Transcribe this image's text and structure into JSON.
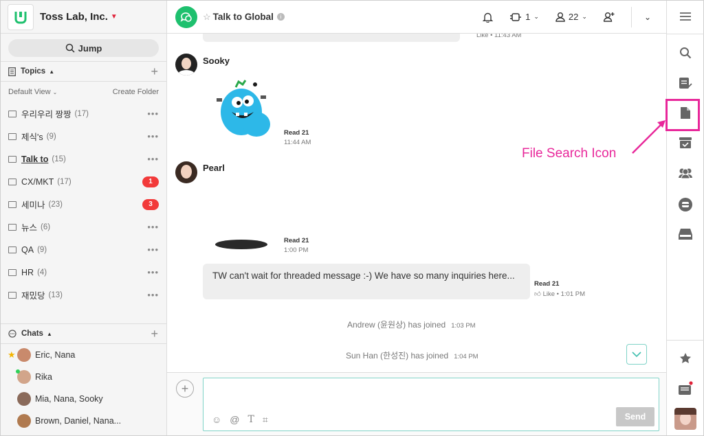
{
  "team": {
    "name": "Toss Lab, Inc."
  },
  "jump": {
    "label": "Jump"
  },
  "topics": {
    "header": "Topics",
    "view_label": "Default View",
    "create_folder": "Create Folder",
    "items": [
      {
        "name": "우리우리 짱짱",
        "count": "(17)",
        "badge": ""
      },
      {
        "name": "제식's",
        "count": "(9)",
        "badge": ""
      },
      {
        "name": "Talk to",
        "count": "(15)",
        "badge": ""
      },
      {
        "name": "CX/MKT",
        "count": "(17)",
        "badge": "1"
      },
      {
        "name": "세미나",
        "count": "(23)",
        "badge": "3"
      },
      {
        "name": "뉴스",
        "count": "(6)",
        "badge": ""
      },
      {
        "name": "QA",
        "count": "(9)",
        "badge": ""
      },
      {
        "name": "HR",
        "count": "(4)",
        "badge": ""
      },
      {
        "name": "재밌당",
        "count": "(13)",
        "badge": ""
      }
    ]
  },
  "chats": {
    "header": "Chats",
    "items": [
      {
        "name": "Eric, Nana"
      },
      {
        "name": "Rika"
      },
      {
        "name": "Mia, Nana, Sooky"
      },
      {
        "name": "Brown, Daniel, Nana..."
      }
    ]
  },
  "room": {
    "name": "Talk to Global",
    "notif_count": "1",
    "member_count": "22"
  },
  "messages": {
    "top_meta": "Like • 11:43 AM",
    "sooky": {
      "author": "Sooky",
      "read": "Read 21",
      "time": "11:44 AM"
    },
    "pearl": {
      "author": "Pearl",
      "read": "Read 21",
      "time": "1:00 PM"
    },
    "bubble": {
      "text": "TW can't wait for threaded message :-) We have so many inquiries here...",
      "read": "Read 21",
      "meta": "Like • 1:01 PM"
    },
    "sys1": {
      "text": "Andrew (윤원상) has joined",
      "time": "1:03 PM"
    },
    "sys2": {
      "text": "Sun Han (한성진) has joined",
      "time": "1:04 PM"
    }
  },
  "composer": {
    "send": "Send"
  },
  "annotation": {
    "label": "File Search Icon",
    "color": "#e8279a"
  },
  "colors": {
    "accent": "#1ec06e",
    "badge": "#f23a3a",
    "highlight": "#e8279a"
  }
}
